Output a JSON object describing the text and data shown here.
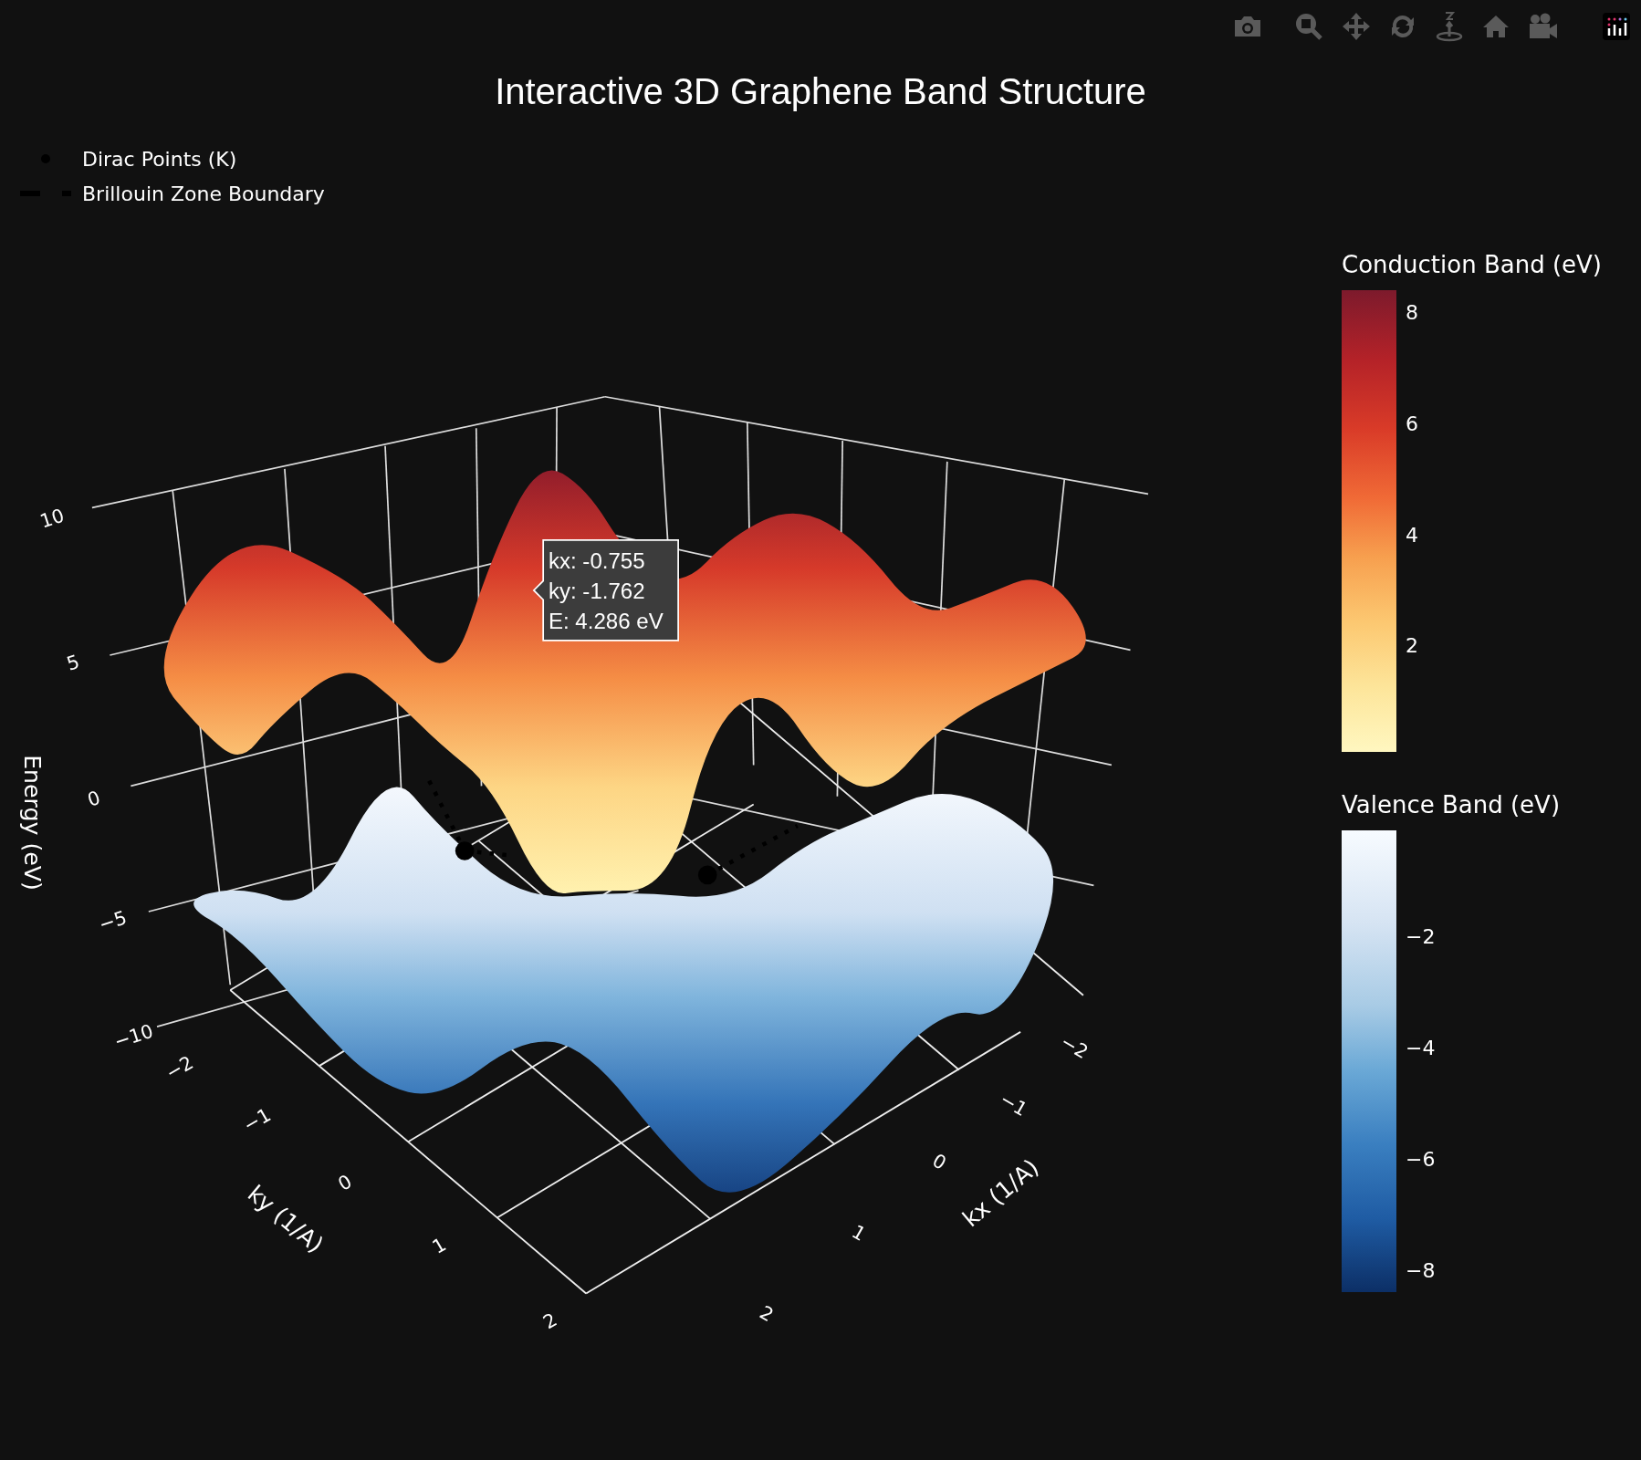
{
  "title": "Interactive 3D Graphene Band Structure",
  "legend": [
    {
      "kind": "marker",
      "label": "Dirac Points (K)"
    },
    {
      "kind": "dash",
      "label": "Brillouin Zone Boundary"
    }
  ],
  "scene": {
    "z_axis": {
      "title": "Energy (eV)",
      "ticks": [
        "10",
        "5",
        "0",
        "−5",
        "−10"
      ]
    },
    "y_axis": {
      "title": "ky (1/A)",
      "ticks": [
        "−2",
        "−1",
        "0",
        "1",
        "2"
      ]
    },
    "x_axis": {
      "title": "kx (1/A)",
      "ticks": [
        "−2",
        "−1",
        "0",
        "1",
        "2"
      ]
    },
    "tooltip": [
      "kx: -0.755",
      "ky: -1.762",
      "E: 4.286 eV"
    ]
  },
  "colorbars": [
    {
      "title": "Conduction Band (eV)",
      "kind": "warm",
      "ticks": [
        "8",
        "6",
        "4",
        "2"
      ]
    },
    {
      "title": "Valence Band (eV)",
      "kind": "cool",
      "ticks": [
        "−2",
        "−4",
        "−6",
        "−8"
      ]
    }
  ]
}
